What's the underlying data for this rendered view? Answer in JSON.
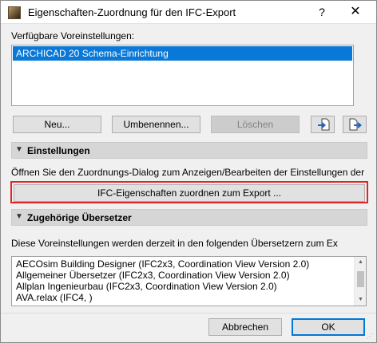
{
  "window": {
    "title": "Eigenschaften-Zuordnung für den IFC-Export",
    "help_glyph": "?",
    "close_glyph": "✕"
  },
  "presets": {
    "label": "Verfügbare Voreinstellungen:",
    "items": [
      "ARCHICAD 20 Schema-Einrichtung"
    ],
    "selected_index": 0
  },
  "buttons": {
    "new": "Neu...",
    "rename": "Umbenennen...",
    "delete": "Löschen",
    "import_icon": "import-icon",
    "export_icon": "export-icon"
  },
  "settings": {
    "header": "Einstellungen",
    "description": "Öffnen Sie den Zuordnungs-Dialog zum Anzeigen/Bearbeiten der Einstellungen der ak",
    "map_button": "IFC-Eigenschaften zuordnen zum Export ..."
  },
  "translators": {
    "header": "Zugehörige Übersetzer",
    "description": "Diese Voreinstellungen werden derzeit in den folgenden Übersetzern zum Ex",
    "items": [
      "AECOsim Building Designer (IFC2x3, Coordination View Version 2.0)",
      "Allgemeiner Übersetzer (IFC2x3, Coordination View Version 2.0)",
      "Allplan Ingenieurbau (IFC2x3, Coordination View Version 2.0)",
      "AVA.relax (IFC4, )"
    ]
  },
  "footer": {
    "cancel": "Abbrechen",
    "ok": "OK"
  },
  "colors": {
    "selection": "#0a78d7",
    "highlight_border": "#e0262b",
    "default_button_border": "#0078d7"
  }
}
